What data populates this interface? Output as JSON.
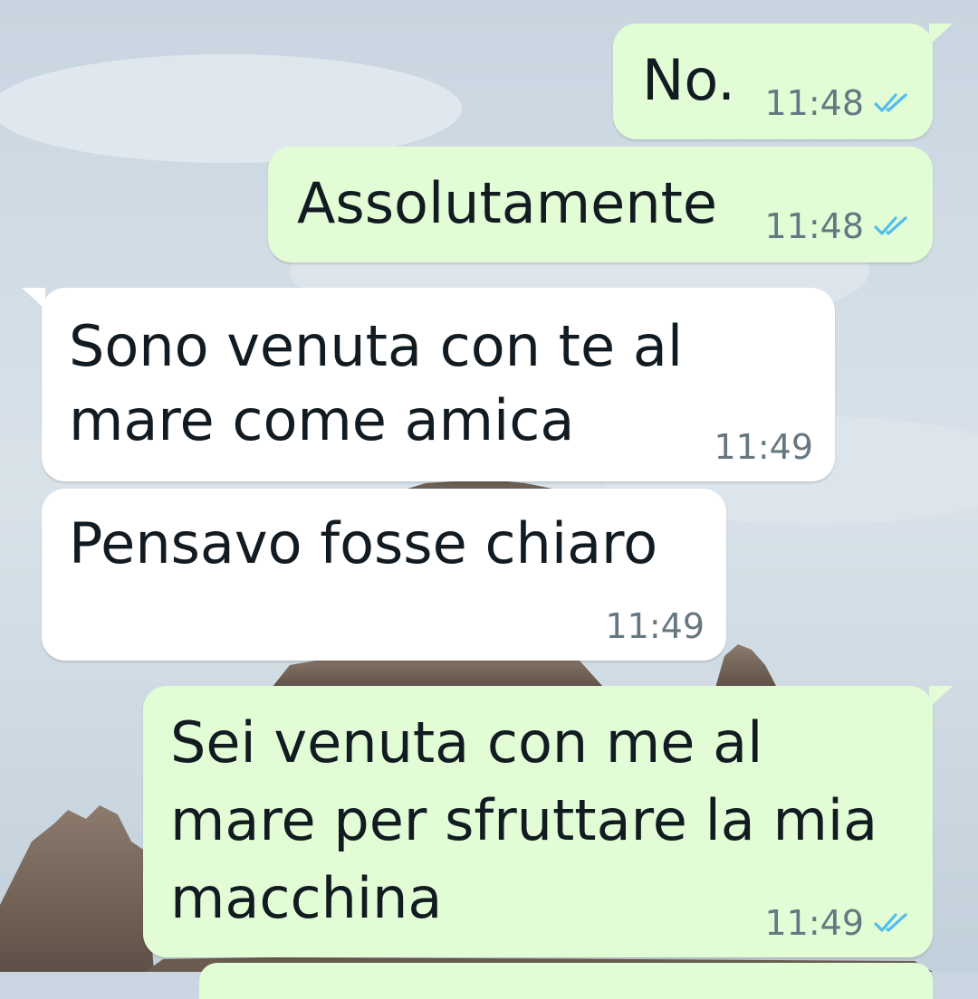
{
  "colors": {
    "accent_top_bar": "#0b7a5e",
    "outgoing_bubble": "#e2fdd6",
    "incoming_bubble": "#ffffff",
    "tick_read": "#53bdeb",
    "time_text": "#667781",
    "message_text": "#111b21"
  },
  "messages": [
    {
      "direction": "outgoing",
      "text": "No.",
      "time": "11:48",
      "status": "read",
      "status_icon": "double-check-icon"
    },
    {
      "direction": "outgoing",
      "text": "Assolutamente",
      "time": "11:48",
      "status": "read",
      "status_icon": "double-check-icon"
    },
    {
      "direction": "incoming",
      "text_lines": [
        "Sono venuta con te al",
        "mare come amica"
      ],
      "time": "11:49"
    },
    {
      "direction": "incoming",
      "text": "Pensavo fosse chiaro",
      "time": "11:49"
    },
    {
      "direction": "outgoing",
      "text_lines": [
        "Sei venuta con me al",
        "mare per sfruttare la mia",
        "macchina"
      ],
      "time": "11:49",
      "status": "read",
      "status_icon": "double-check-icon"
    }
  ]
}
